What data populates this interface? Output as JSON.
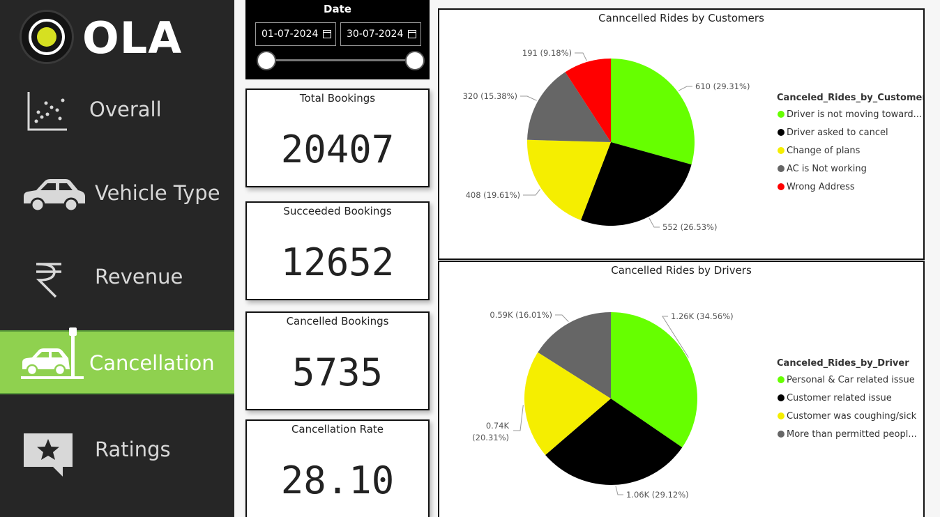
{
  "logo": {
    "text": "OLA"
  },
  "sidebar": {
    "items": [
      {
        "label": "Overall",
        "icon": "scatter-chart-icon",
        "active": false
      },
      {
        "label": "Vehicle Type",
        "icon": "car-icon",
        "active": false
      },
      {
        "label": "Revenue",
        "icon": "rupee-icon",
        "active": false
      },
      {
        "label": "Cancellation",
        "icon": "car-crash-icon",
        "active": true
      },
      {
        "label": "Ratings",
        "icon": "star-message-icon",
        "active": false
      }
    ]
  },
  "date_filter": {
    "title": "Date",
    "start": "01-07-2024",
    "end": "30-07-2024"
  },
  "kpis": [
    {
      "title": "Total Bookings",
      "value": "20407"
    },
    {
      "title": "Succeeded Bookings",
      "value": "12652"
    },
    {
      "title": "Cancelled Bookings",
      "value": "5735"
    },
    {
      "title": "Cancellation Rate",
      "value": "28.10"
    }
  ],
  "colors": {
    "green": "#66ff00",
    "black": "#000000",
    "yellow": "#f5ee00",
    "gray": "#666666",
    "red": "#ff0000",
    "active_nav": "#8fd14f"
  },
  "chart_data": [
    {
      "type": "pie",
      "title": "Canncelled Rides by Customers",
      "legend_title": "Canceled_Rides_by_Customer",
      "legend_position": "right",
      "slices": [
        {
          "name": "Driver is not moving toward...",
          "value": 610,
          "label": "610 (29.31%)",
          "color": "#66ff00"
        },
        {
          "name": "Driver asked to cancel",
          "value": 552,
          "label": "552 (26.53%)",
          "color": "#000000"
        },
        {
          "name": "Change of plans",
          "value": 408,
          "label": "408 (19.61%)",
          "color": "#f5ee00"
        },
        {
          "name": "AC is Not working",
          "value": 320,
          "label": "320 (15.38%)",
          "color": "#666666"
        },
        {
          "name": "Wrong Address",
          "value": 191,
          "label": "191 (9.18%)",
          "color": "#ff0000"
        }
      ]
    },
    {
      "type": "pie",
      "title": "Cancelled Rides by Drivers",
      "legend_title": "Canceled_Rides_by_Driver",
      "legend_position": "right",
      "slices": [
        {
          "name": "Personal & Car related issue",
          "value": 34.56,
          "label": "1.26K (34.56%)",
          "color": "#66ff00"
        },
        {
          "name": "Customer related issue",
          "value": 29.12,
          "label": "1.06K (29.12%)",
          "color": "#000000"
        },
        {
          "name": "Customer was coughing/sick",
          "value": 20.31,
          "label_line1": "0.74K",
          "label_line2": "(20.31%)",
          "color": "#f5ee00"
        },
        {
          "name": "More than permitted peopl...",
          "value": 16.01,
          "label": "0.59K (16.01%)",
          "color": "#666666"
        }
      ]
    }
  ]
}
